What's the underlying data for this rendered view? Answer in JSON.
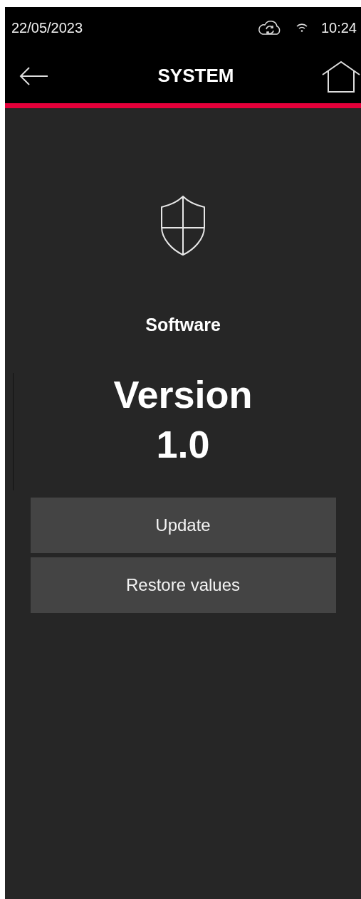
{
  "status_bar": {
    "date": "22/05/2023",
    "time": "10:24"
  },
  "header": {
    "title": "SYSTEM"
  },
  "content": {
    "label": "Software",
    "version_lines": [
      "Version",
      "1.0"
    ]
  },
  "buttons": [
    {
      "label": "Update"
    },
    {
      "label": "Restore values"
    }
  ]
}
